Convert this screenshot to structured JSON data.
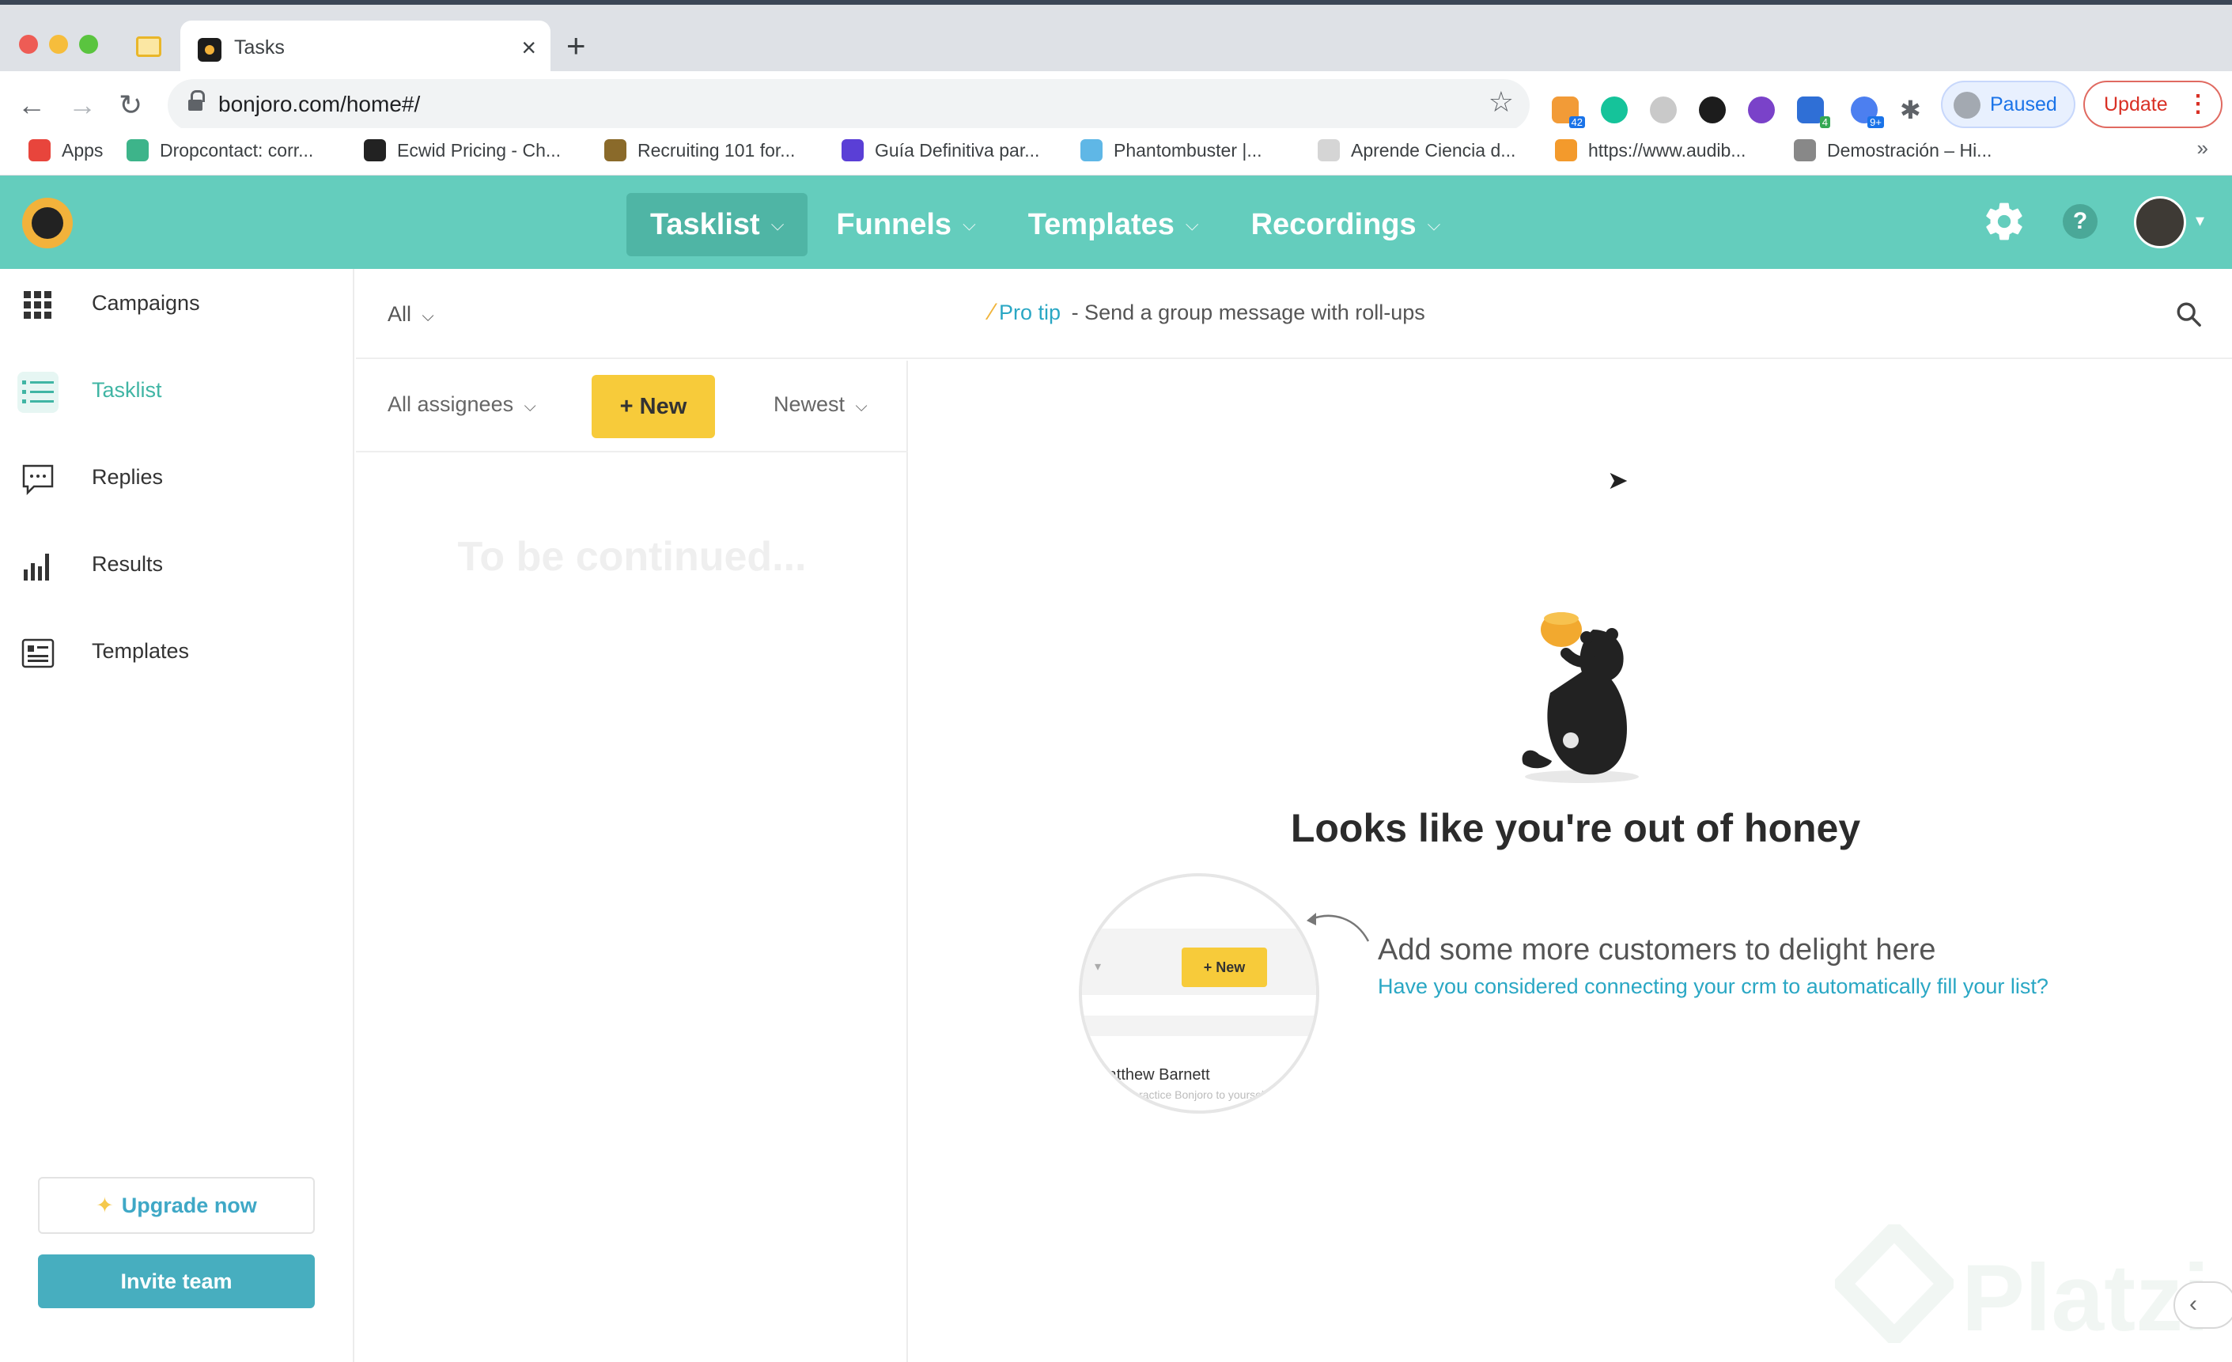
{
  "browser": {
    "tab_title": "Tasks",
    "tab_close": "×",
    "new_tab": "+",
    "url": "bonjoro.com/home#/",
    "profile_status": "Paused",
    "update_label": "Update",
    "update_menu": "⋮",
    "bookmarks": [
      {
        "label": "Apps",
        "icon": "apps-grid-icon",
        "color": "#e8453c"
      },
      {
        "label": "Dropcontact: corr...",
        "icon": "dropcontact-icon",
        "color": "#3db48a"
      },
      {
        "label": "Ecwid Pricing - Ch...",
        "icon": "ecwid-icon",
        "color": "#222222"
      },
      {
        "label": "Recruiting 101 for...",
        "icon": "recruiting-icon",
        "color": "#8a6a2a"
      },
      {
        "label": "Guía Definitiva par...",
        "icon": "guide-icon",
        "color": "#5a3fd6"
      },
      {
        "label": "Phantombuster |...",
        "icon": "phantombuster-icon",
        "color": "#5fb7e6"
      },
      {
        "label": "Aprende Ciencia d...",
        "icon": "aprende-icon",
        "color": "#d5d5d5"
      },
      {
        "label": "https://www.audib...",
        "icon": "audible-icon",
        "color": "#f39a2c"
      },
      {
        "label": "Demostración – Hi...",
        "icon": "demo-icon",
        "color": "#888888"
      }
    ],
    "bookmarks_more": "»",
    "extension_badges": {
      "first": "42",
      "fifth": "4",
      "sixth": "9+"
    }
  },
  "app": {
    "nav": [
      {
        "label": "Tasklist",
        "active": true
      },
      {
        "label": "Funnels",
        "active": false
      },
      {
        "label": "Templates",
        "active": false
      },
      {
        "label": "Recordings",
        "active": false
      }
    ],
    "help_glyph": "?"
  },
  "sidebar": {
    "items": [
      {
        "label": "Campaigns",
        "icon": "grid-icon",
        "active": false
      },
      {
        "label": "Tasklist",
        "icon": "list-icon",
        "active": true
      },
      {
        "label": "Replies",
        "icon": "chat-icon",
        "active": false
      },
      {
        "label": "Results",
        "icon": "bar-chart-icon",
        "active": false
      },
      {
        "label": "Templates",
        "icon": "template-card-icon",
        "active": false
      }
    ],
    "upgrade_label": "Upgrade now",
    "invite_label": "Invite team"
  },
  "filter_bar": {
    "scope": "All",
    "protip_link": "Pro tip",
    "protip_text": " - Send a group message with roll-ups"
  },
  "task_list": {
    "assignees": "All assignees",
    "new_label": "New",
    "sort": "Newest",
    "empty_text": "To be continued..."
  },
  "empty_state": {
    "title": "Looks like you're out of honey",
    "hint": "Add some more customers to delight here",
    "link": "Have you considered connecting your crm to automatically fill your list?",
    "illustration": {
      "new_label": "+ New",
      "name": "Matthew Barnett",
      "sub": "Send a practice Bonjoro to yourself"
    }
  },
  "watermark": "Platzi",
  "colors": {
    "header": "#64cdbd",
    "accent": "#40b5a4",
    "new_button": "#f7cb3a",
    "invite_button": "#47aebf",
    "link": "#2aa7c4"
  }
}
